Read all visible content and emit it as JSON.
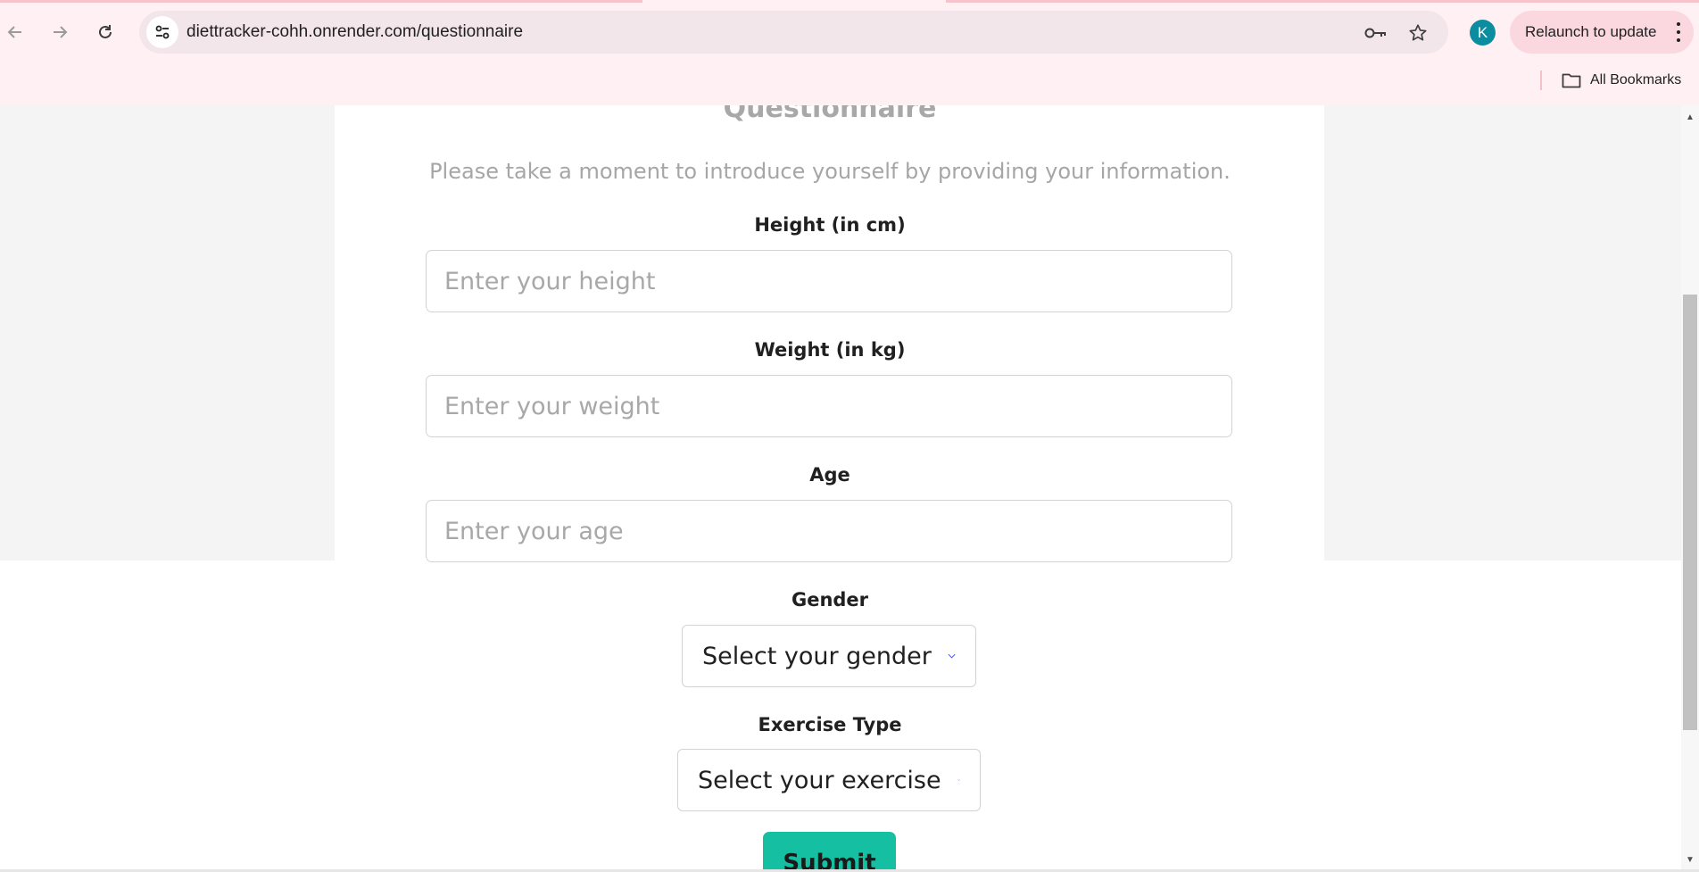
{
  "browser": {
    "url": "diettracker-cohh.onrender.com/questionnaire",
    "avatar_letter": "K",
    "relaunch_label": "Relaunch to update",
    "bookmarks_label": "All Bookmarks",
    "icons": {
      "back": "arrow-back-icon",
      "forward": "arrow-forward-icon",
      "reload": "reload-icon",
      "site_info": "tune-icon",
      "password": "key-icon",
      "bookmark": "star-icon",
      "menu": "kebab-menu-icon",
      "folder": "folder-icon"
    }
  },
  "page": {
    "title": "Questionnaire",
    "subtitle": "Please take a moment to introduce yourself by providing your information.",
    "fields": {
      "height": {
        "label": "Height (in cm)",
        "placeholder": "Enter your height",
        "value": ""
      },
      "weight": {
        "label": "Weight (in kg)",
        "placeholder": "Enter your weight",
        "value": ""
      },
      "age": {
        "label": "Age",
        "placeholder": "Enter your age",
        "value": ""
      },
      "gender": {
        "label": "Gender",
        "selected": "Select your gender"
      },
      "exercise": {
        "label": "Exercise Type",
        "selected": "Select your exercise"
      }
    },
    "submit_label": "Submit"
  },
  "colors": {
    "accent_chevron": "#3d4cf0",
    "submit_bg": "#14bfa2",
    "avatar_bg": "#0b8d9f",
    "chrome_bg": "#fff1f3",
    "relaunch_bg": "#fbd8df"
  }
}
